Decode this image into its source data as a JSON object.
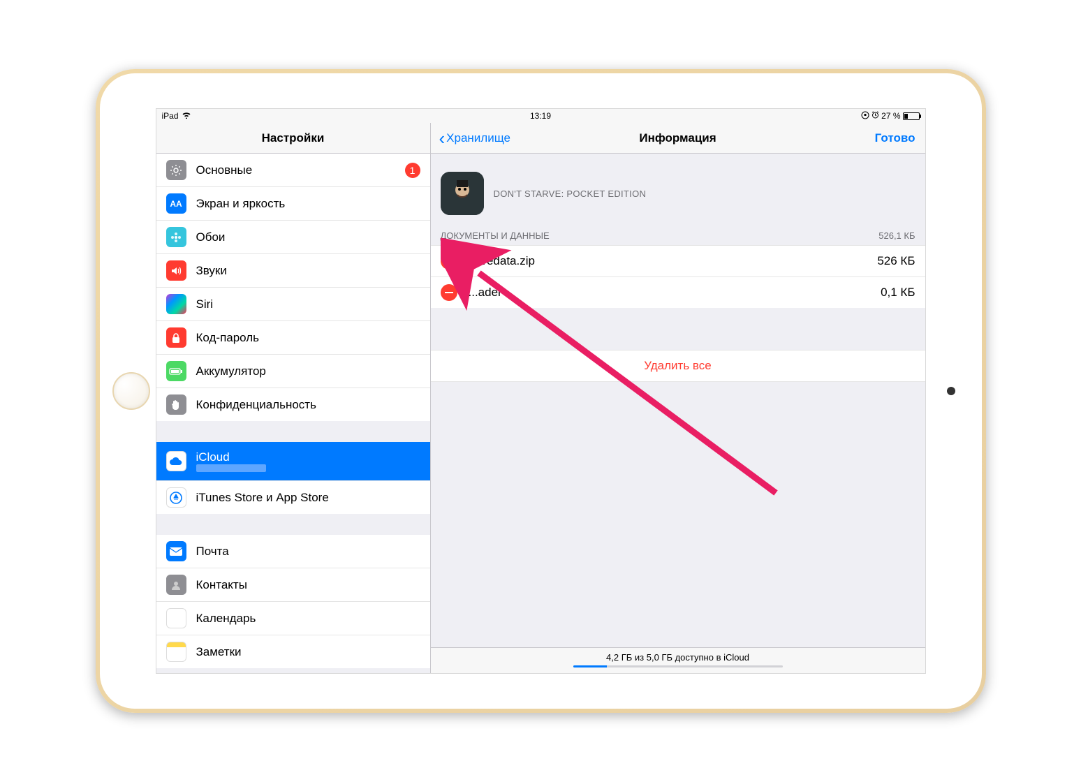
{
  "status": {
    "device": "iPad",
    "time": "13:19",
    "battery_pct": "27 %"
  },
  "sidebar": {
    "title": "Настройки",
    "items": {
      "general": "Основные",
      "general_badge": "1",
      "display": "Экран и яркость",
      "wallpaper": "Обои",
      "sounds": "Звуки",
      "siri": "Siri",
      "passcode": "Код-пароль",
      "battery": "Аккумулятор",
      "privacy": "Конфиденциальность",
      "icloud": "iCloud",
      "itunes": "iTunes Store и App Store",
      "mail": "Почта",
      "contacts": "Контакты",
      "calendar": "Календарь",
      "notes": "Заметки"
    }
  },
  "detail": {
    "back": "Хранилище",
    "title": "Информация",
    "done": "Готово",
    "app_name": "DON'T STARVE: POCKET EDITION",
    "docs_header": "ДОКУМЕНТЫ И ДАННЫЕ",
    "docs_total": "526,1 КБ",
    "files": [
      {
        "name": "savedata.zip",
        "size": "526 КБ"
      },
      {
        "name": "...ader",
        "size": "0,1 КБ"
      }
    ],
    "delete_all": "Удалить все",
    "storage_text": "4,2 ГБ из 5,0 ГБ доступно в iCloud"
  }
}
